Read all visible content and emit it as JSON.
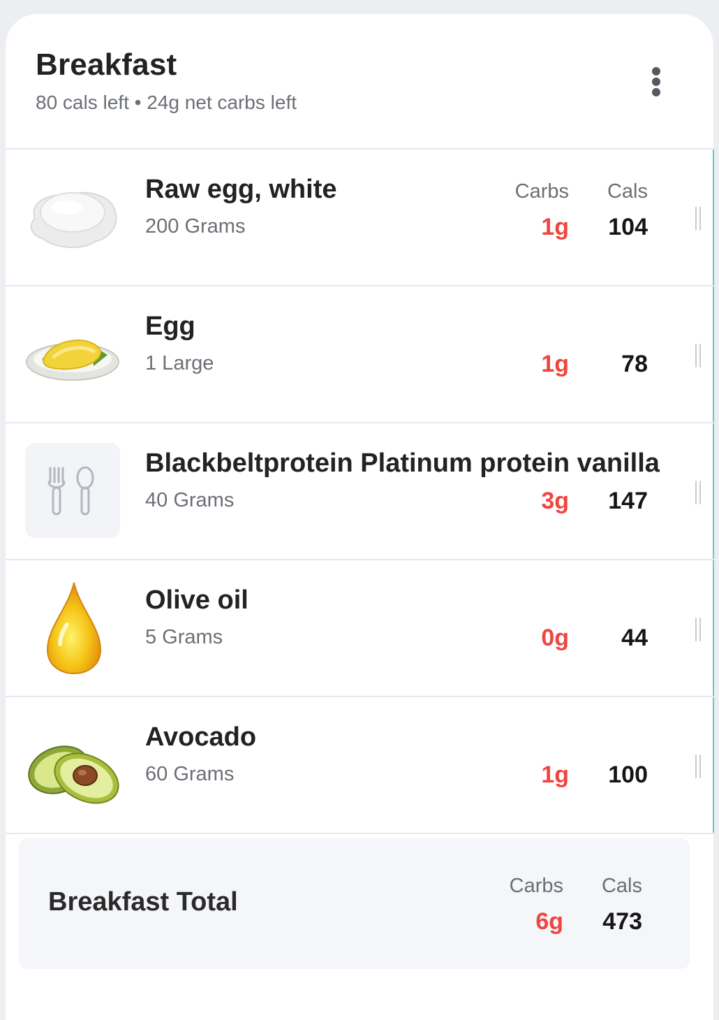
{
  "meal": {
    "title": "Breakfast",
    "summary": "80 cals left • 24g net carbs left",
    "menu_icon": "more-vertical-icon"
  },
  "columns": {
    "carbs": "Carbs",
    "cals": "Cals"
  },
  "items": [
    {
      "name": "Raw egg, white",
      "quantity": "200 Grams",
      "carbs": "1g",
      "cals": "104",
      "icon": "egg-white-icon"
    },
    {
      "name": "Egg",
      "quantity": "1 Large",
      "carbs": "1g",
      "cals": "78",
      "icon": "omelette-icon"
    },
    {
      "name": "Blackbeltprotein Platinum protein vanilla",
      "quantity": "40 Grams",
      "carbs": "3g",
      "cals": "147",
      "icon": "utensils-icon"
    },
    {
      "name": "Olive oil",
      "quantity": "5 Grams",
      "carbs": "0g",
      "cals": "44",
      "icon": "oil-drop-icon"
    },
    {
      "name": "Avocado",
      "quantity": "60 Grams",
      "carbs": "1g",
      "cals": "100",
      "icon": "avocado-icon"
    }
  ],
  "total": {
    "label": "Breakfast Total",
    "carbs": "6g",
    "cals": "473"
  },
  "colors": {
    "carbs": "#f0453f",
    "accent": "#5dd3b5"
  }
}
